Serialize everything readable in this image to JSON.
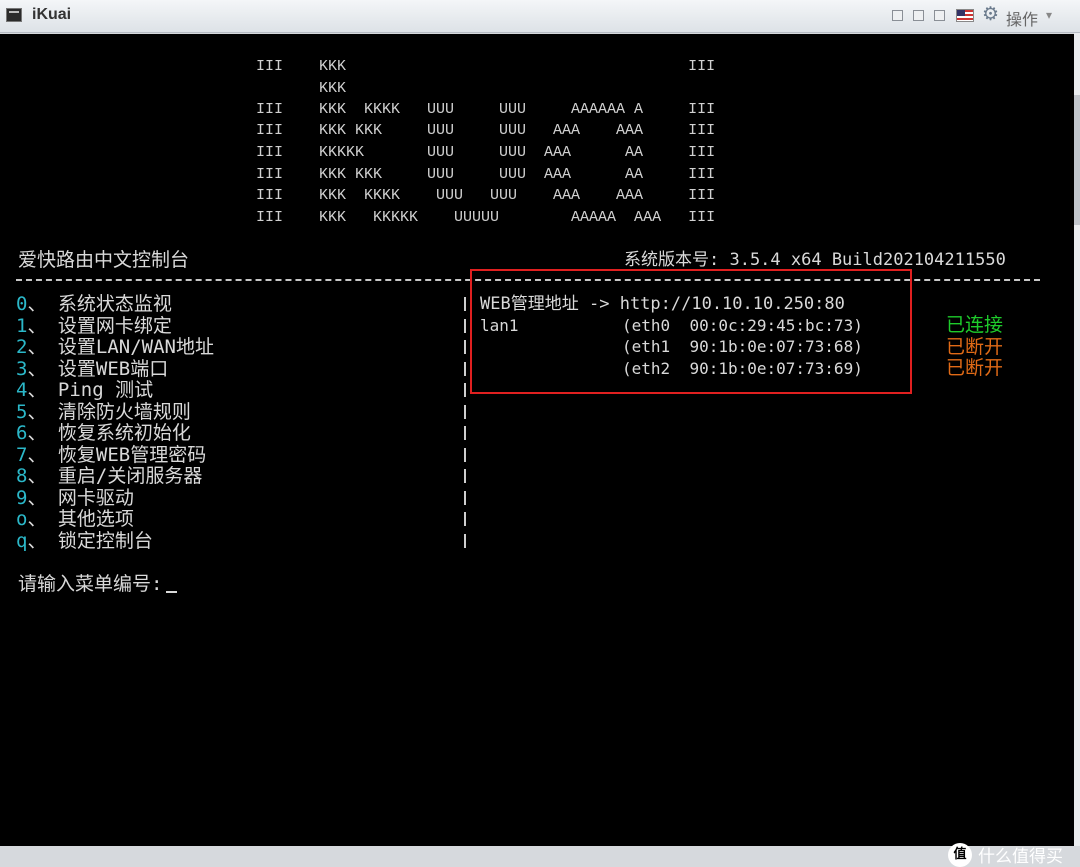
{
  "window": {
    "title": "iKuai",
    "ops_label": "操作",
    "ops_caret": "▾"
  },
  "logo": [
    "III    KKK                                      III",
    "       KKK",
    "III    KKK  KKKK   UUU     UUU     AAAAAA A     III",
    "III    KKK KKK     UUU     UUU   AAA    AAA     III",
    "III    KKKKK       UUU     UUU  AAA      AA     III",
    "III    KKK KKK     UUU     UUU  AAA      AA     III",
    "III    KKK  KKKK    UUU   UUU    AAA    AAA     III",
    "III    KKK   KKKKK    UUUUU        AAAAA  AAA   III"
  ],
  "header": {
    "console_title": "爱快路由中文控制台",
    "version": "系统版本号: 3.5.4 x64 Build202104211550"
  },
  "menu": [
    {
      "key": "0",
      "sep": "、",
      "label": "系统状态监视"
    },
    {
      "key": "1",
      "sep": "、",
      "label": "设置网卡绑定"
    },
    {
      "key": "2",
      "sep": "、",
      "label": "设置LAN/WAN地址"
    },
    {
      "key": "3",
      "sep": "、",
      "label": "设置WEB端口"
    },
    {
      "key": "4",
      "sep": "、",
      "label": "Ping 测试"
    },
    {
      "key": "5",
      "sep": "、",
      "label": "清除防火墙规则"
    },
    {
      "key": "6",
      "sep": "、",
      "label": "恢复系统初始化"
    },
    {
      "key": "7",
      "sep": "、",
      "label": "恢复WEB管理密码"
    },
    {
      "key": "8",
      "sep": "、",
      "label": "重启/关闭服务器"
    },
    {
      "key": "9",
      "sep": "、",
      "label": "网卡驱动"
    },
    {
      "key": "o",
      "sep": "、",
      "label": "其他选项"
    },
    {
      "key": "q",
      "sep": "、",
      "label": "锁定控制台"
    }
  ],
  "network": {
    "web_label": "WEB管理地址",
    "web_arrow": "->",
    "web_url": "http://10.10.10.250:80",
    "lan_name": "lan1",
    "interfaces": [
      {
        "iface": "(eth0",
        "mac": "00:0c:29:45:bc:73)",
        "status": "已连接"
      },
      {
        "iface": "(eth1",
        "mac": "90:1b:0e:07:73:68)",
        "status": "已断开"
      },
      {
        "iface": "(eth2",
        "mac": "90:1b:0e:07:73:69)",
        "status": "已断开"
      }
    ]
  },
  "prompt": "请输入菜单编号:",
  "watermark": {
    "icon": "值",
    "text": "什么值得买"
  },
  "colors": {
    "menu_key": "#2bb8c9",
    "connected": "#1ecb2b",
    "disconnected": "#e06a16",
    "highlight": "#e02020"
  }
}
